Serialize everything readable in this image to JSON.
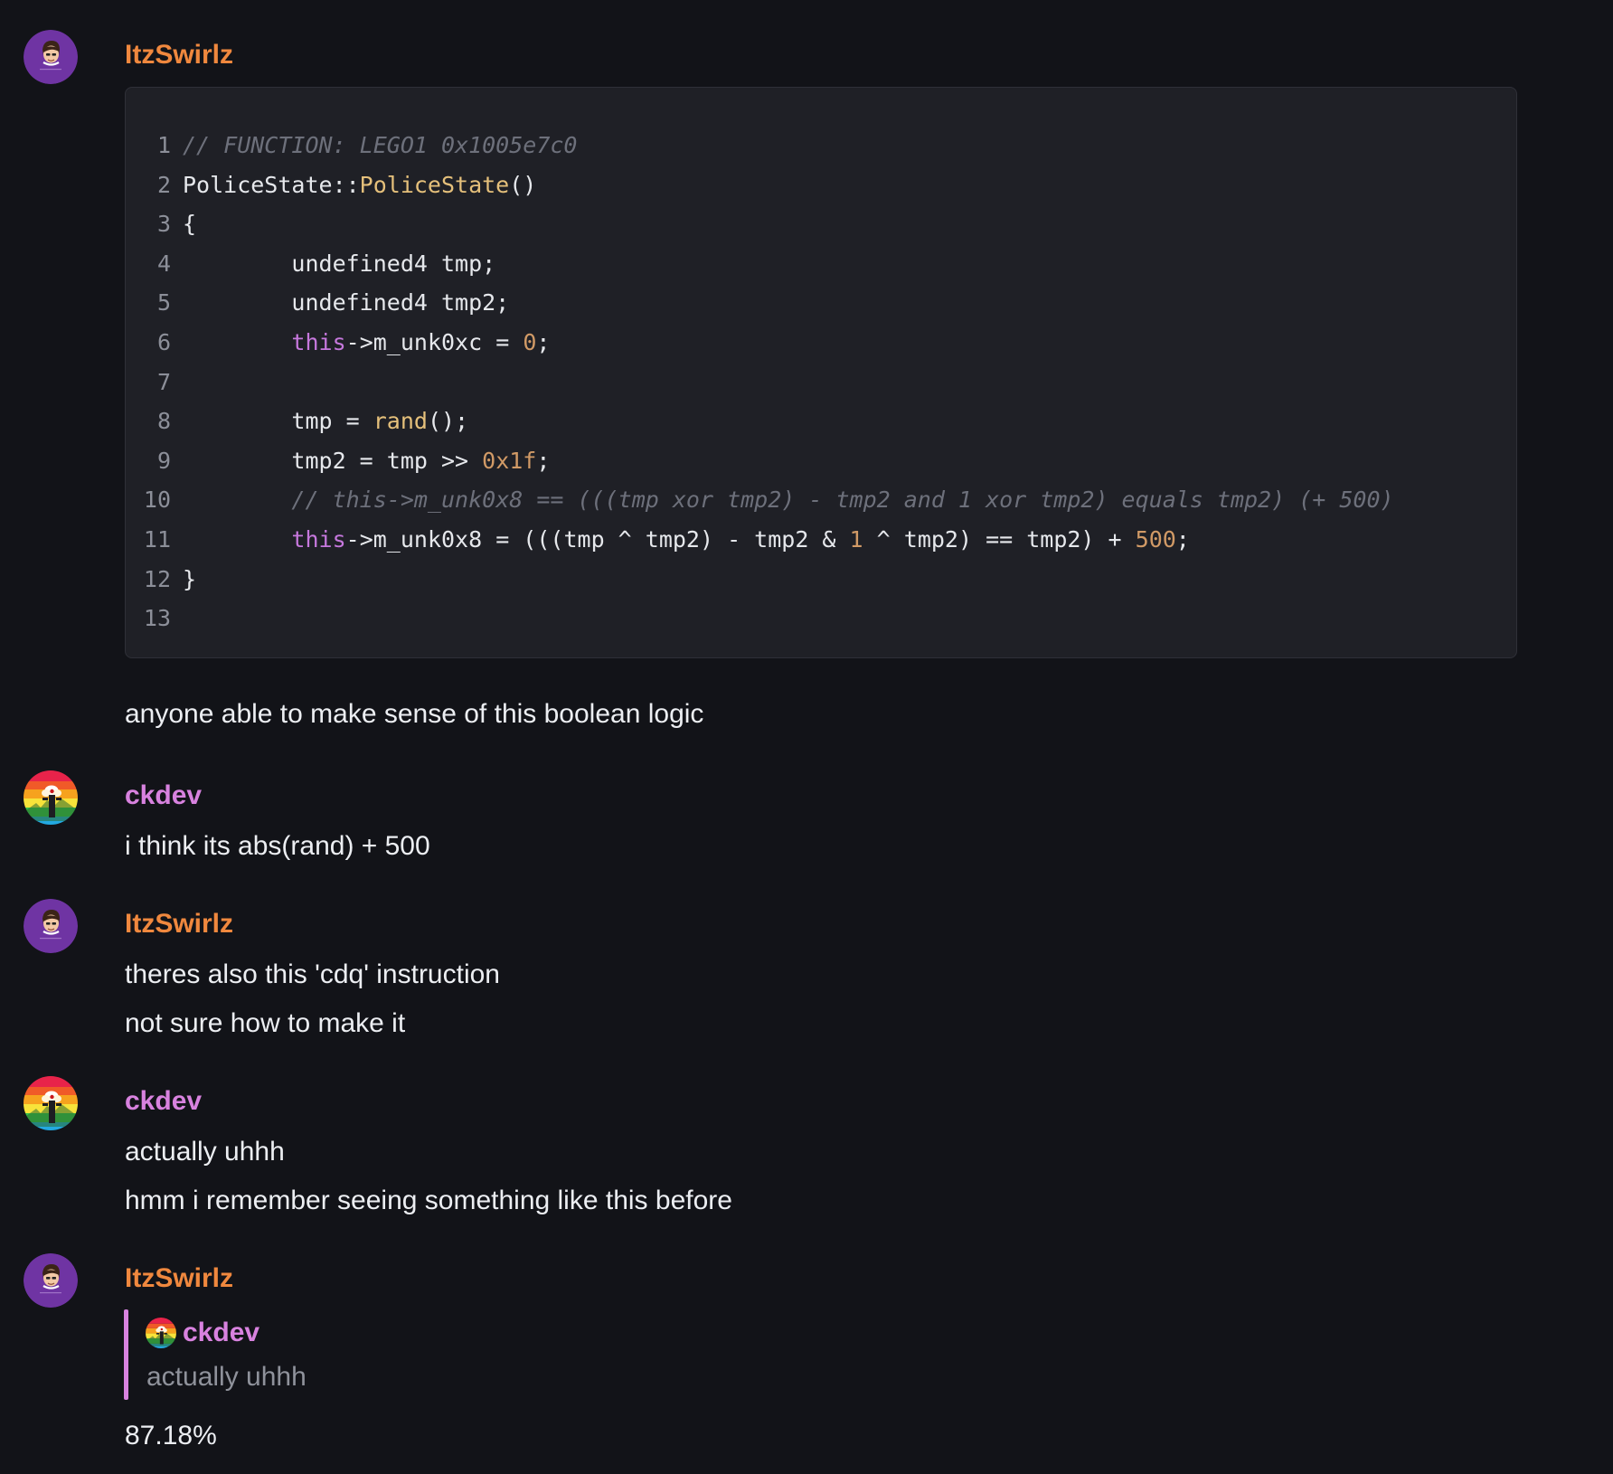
{
  "colors": {
    "background": "#121318",
    "code_background": "#1f2026",
    "author_itzswirlz": "#f0883e",
    "author_ckdev": "#d882df",
    "text": "#eceef2",
    "comment": "#6d707b",
    "keyword": "#c678dd",
    "function": "#e5c07b",
    "number": "#d19a66",
    "reply_bar": "#d882df"
  },
  "messages": [
    {
      "author": "ItzSwirlz",
      "avatar_icon": "purple-cartoon-face-avatar",
      "code": {
        "lines": [
          {
            "n": "1",
            "tokens": [
              {
                "t": "// FUNCTION: LEGO1 0x1005e7c0",
                "c": "comment"
              }
            ]
          },
          {
            "n": "2",
            "tokens": [
              {
                "t": "PoliceState::",
                "c": "plain"
              },
              {
                "t": "PoliceState",
                "c": "func"
              },
              {
                "t": "()",
                "c": "plain"
              }
            ]
          },
          {
            "n": "3",
            "tokens": [
              {
                "t": "{",
                "c": "plain"
              }
            ]
          },
          {
            "n": "4",
            "tokens": [
              {
                "t": "        undefined4 tmp;",
                "c": "plain"
              }
            ]
          },
          {
            "n": "5",
            "tokens": [
              {
                "t": "        undefined4 tmp2;",
                "c": "plain"
              }
            ]
          },
          {
            "n": "6",
            "tokens": [
              {
                "t": "        ",
                "c": "plain"
              },
              {
                "t": "this",
                "c": "keyword"
              },
              {
                "t": "->m_unk0xc = ",
                "c": "plain"
              },
              {
                "t": "0",
                "c": "num"
              },
              {
                "t": ";",
                "c": "plain"
              }
            ]
          },
          {
            "n": "7",
            "tokens": []
          },
          {
            "n": "8",
            "tokens": [
              {
                "t": "        tmp = ",
                "c": "plain"
              },
              {
                "t": "rand",
                "c": "func"
              },
              {
                "t": "();",
                "c": "plain"
              }
            ]
          },
          {
            "n": "9",
            "tokens": [
              {
                "t": "        tmp2 = tmp >> ",
                "c": "plain"
              },
              {
                "t": "0x1f",
                "c": "num"
              },
              {
                "t": ";",
                "c": "plain"
              }
            ]
          },
          {
            "n": "10",
            "tokens": [
              {
                "t": "        ",
                "c": "plain"
              },
              {
                "t": "// this->m_unk0x8 == (((tmp xor tmp2) - tmp2 and 1 xor tmp2) equals tmp2) (+ 500)",
                "c": "comment"
              }
            ]
          },
          {
            "n": "11",
            "tokens": [
              {
                "t": "        ",
                "c": "plain"
              },
              {
                "t": "this",
                "c": "keyword"
              },
              {
                "t": "->m_unk0x8 = (((tmp ^ tmp2) - tmp2 & ",
                "c": "plain"
              },
              {
                "t": "1",
                "c": "num"
              },
              {
                "t": " ^ tmp2) == tmp2) + ",
                "c": "plain"
              },
              {
                "t": "500",
                "c": "num"
              },
              {
                "t": ";",
                "c": "plain"
              }
            ]
          },
          {
            "n": "12",
            "tokens": [
              {
                "t": "}",
                "c": "plain"
              }
            ]
          },
          {
            "n": "13",
            "tokens": []
          }
        ]
      },
      "text": [
        "anyone able to make sense of this boolean logic"
      ]
    },
    {
      "author": "ckdev",
      "avatar_icon": "rainbow-avatar",
      "text": [
        "i think its abs(rand) + 500"
      ]
    },
    {
      "author": "ItzSwirlz",
      "avatar_icon": "purple-cartoon-face-avatar",
      "text": [
        "theres also this 'cdq' instruction",
        "not sure how to make it"
      ]
    },
    {
      "author": "ckdev",
      "avatar_icon": "rainbow-avatar",
      "text": [
        "actually uhhh",
        "hmm i remember seeing something like this before"
      ]
    },
    {
      "author": "ItzSwirlz",
      "avatar_icon": "purple-cartoon-face-avatar",
      "reply": {
        "author": "ckdev",
        "avatar_icon": "rainbow-avatar",
        "text": "actually uhhh"
      },
      "text": [
        "87.18%"
      ]
    }
  ]
}
